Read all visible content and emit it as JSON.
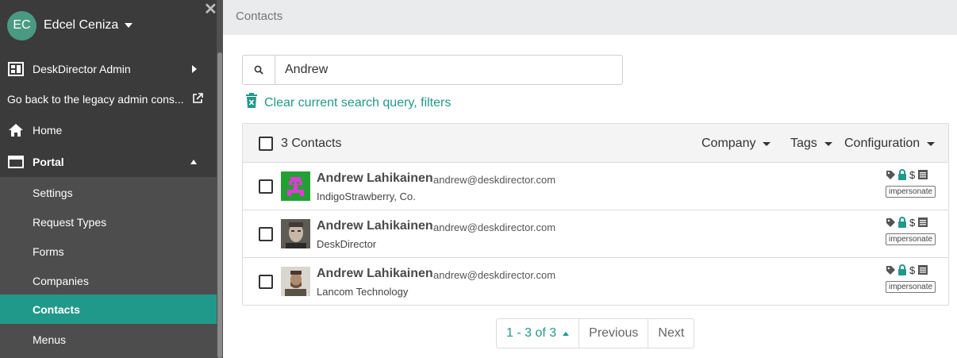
{
  "sidebar": {
    "user": {
      "initials": "EC",
      "name": "Edcel Ceniza"
    },
    "close_glyph": "✕",
    "admin_label": "DeskDirector Admin",
    "legacy_label": "Go back to the legacy admin cons...",
    "home_label": "Home",
    "portal_label": "Portal",
    "sub_items": [
      {
        "label": "Settings"
      },
      {
        "label": "Request Types"
      },
      {
        "label": "Forms"
      },
      {
        "label": "Companies"
      },
      {
        "label": "Contacts",
        "active": true
      },
      {
        "label": "Menus"
      }
    ]
  },
  "topbar": {
    "title": "Contacts"
  },
  "search": {
    "value": "Andrew",
    "icon": "search-icon"
  },
  "clear_link": {
    "label": "Clear current search query, filters"
  },
  "table": {
    "count_label": "3 Contacts",
    "filters": {
      "company": "Company",
      "tags": "Tags",
      "configuration": "Configuration"
    },
    "rows": [
      {
        "name": "Andrew Lahikainen",
        "email": "andrew@deskdirector.com",
        "company": "IndigoStrawberry, Co.",
        "impersonate": "impersonate",
        "avatar": "pixel-avatar"
      },
      {
        "name": "Andrew Lahikainen",
        "email": "andrew@deskdirector.com",
        "company": "DeskDirector",
        "impersonate": "impersonate",
        "avatar": "photo-avatar"
      },
      {
        "name": "Andrew Lahikainen",
        "email": "andrew@deskdirector.com",
        "company": "Lancom Technology",
        "impersonate": "impersonate",
        "avatar": "photo-avatar"
      }
    ]
  },
  "pager": {
    "range": "1 - 3 of 3",
    "previous": "Previous",
    "next": "Next"
  },
  "colors": {
    "accent": "#21998a",
    "sidebar": "#3b3b3b",
    "sub_sidebar": "#4d4d4d",
    "avatar_green": "#4a9a82"
  }
}
